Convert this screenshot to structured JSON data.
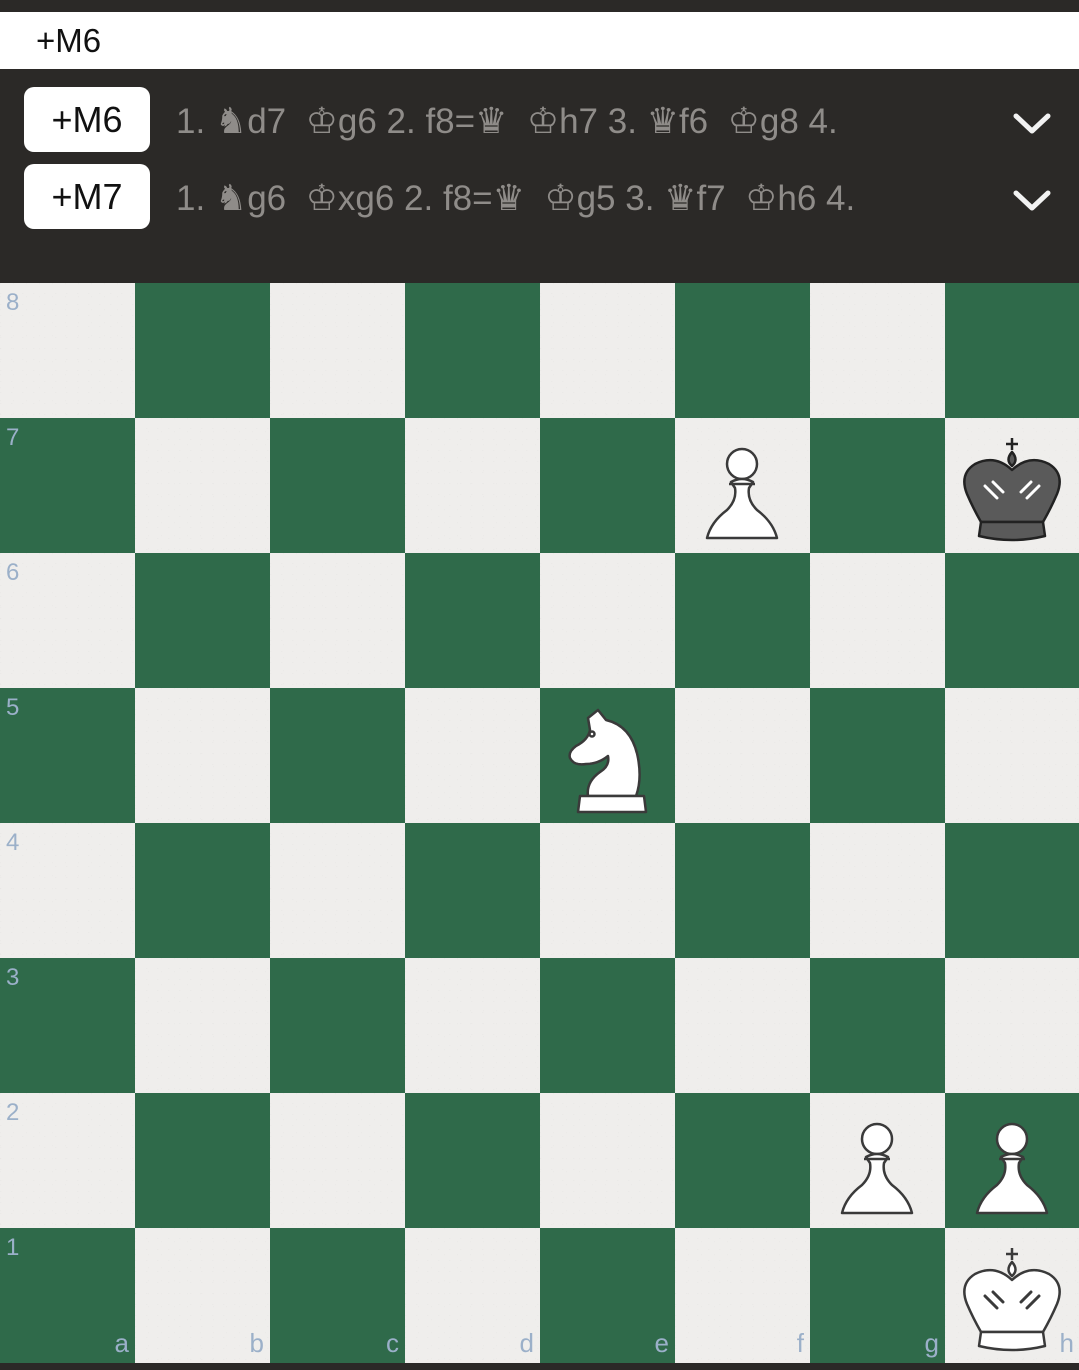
{
  "eval_bar": {
    "score": "+M6"
  },
  "lines": [
    {
      "score": "+M6",
      "moves": [
        {
          "text": "1. "
        },
        {
          "glyph": "♞"
        },
        {
          "text": "d7  "
        },
        {
          "glyph": "♔"
        },
        {
          "text": "g6 2. f8="
        },
        {
          "glyph": "♛"
        },
        {
          "text": "  "
        },
        {
          "glyph": "♔"
        },
        {
          "text": "h7 3. "
        },
        {
          "glyph": "♛"
        },
        {
          "text": "f6  "
        },
        {
          "glyph": "♔"
        },
        {
          "text": "g8 4."
        }
      ]
    },
    {
      "score": "+M7",
      "moves": [
        {
          "text": "1. "
        },
        {
          "glyph": "♞"
        },
        {
          "text": "g6  "
        },
        {
          "glyph": "♔"
        },
        {
          "text": "xg6 2. f8="
        },
        {
          "glyph": "♛"
        },
        {
          "text": "  "
        },
        {
          "glyph": "♔"
        },
        {
          "text": "g5 3. "
        },
        {
          "glyph": "♛"
        },
        {
          "text": "f7  "
        },
        {
          "glyph": "♔"
        },
        {
          "text": "h6 4."
        }
      ]
    }
  ],
  "board": {
    "ranks": [
      "8",
      "7",
      "6",
      "5",
      "4",
      "3",
      "2",
      "1"
    ],
    "files": [
      "a",
      "b",
      "c",
      "d",
      "e",
      "f",
      "g",
      "h"
    ],
    "pieces": [
      {
        "square": "f7",
        "type": "pawn",
        "color": "white"
      },
      {
        "square": "h7",
        "type": "king",
        "color": "black"
      },
      {
        "square": "e5",
        "type": "knight",
        "color": "white"
      },
      {
        "square": "g2",
        "type": "pawn",
        "color": "white"
      },
      {
        "square": "h2",
        "type": "pawn",
        "color": "white"
      },
      {
        "square": "h1",
        "type": "king",
        "color": "white"
      }
    ]
  },
  "colors": {
    "light_square": "#efeeec",
    "dark_square": "#2f6a4a",
    "coordinate": "#9bb0c9",
    "panel_bg": "#2b2927",
    "move_text": "#8f8c89"
  }
}
